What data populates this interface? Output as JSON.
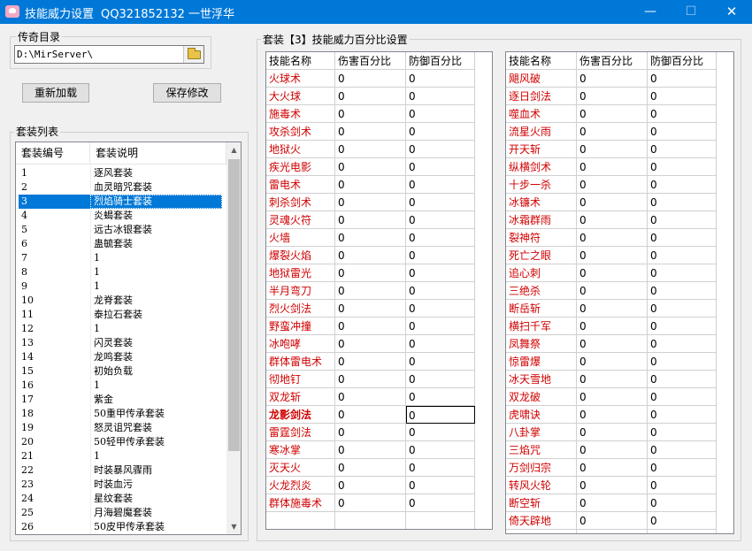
{
  "window": {
    "title": "技能威力设置",
    "subtitle": "QQ321852132 一世浮华",
    "minimize": "—",
    "maximize": "☐",
    "close": "✕"
  },
  "path_group": {
    "label": "传奇目录",
    "path": "D:\\MirServer\\"
  },
  "buttons": {
    "reload": "重新加载",
    "save": "保存修改"
  },
  "suit_list": {
    "label": "套装列表",
    "headers": [
      "套装编号",
      "套装说明"
    ],
    "selected_index": 2,
    "rows": [
      [
        "1",
        "逐风套装"
      ],
      [
        "2",
        "血灵暗咒套装"
      ],
      [
        "3",
        "烈焰骑士套装"
      ],
      [
        "4",
        "炎蝎套装"
      ],
      [
        "5",
        "远古冰银套装"
      ],
      [
        "6",
        "蛊毓套装"
      ],
      [
        "7",
        "1"
      ],
      [
        "8",
        "1"
      ],
      [
        "9",
        "1"
      ],
      [
        "10",
        "龙脊套装"
      ],
      [
        "11",
        "泰拉石套装"
      ],
      [
        "12",
        "1"
      ],
      [
        "13",
        "闪灵套装"
      ],
      [
        "14",
        "龙鸣套装"
      ],
      [
        "15",
        "初始负载"
      ],
      [
        "16",
        "1"
      ],
      [
        "17",
        "紫金"
      ],
      [
        "18",
        "50重甲传承套装"
      ],
      [
        "19",
        "怒灵诅咒套装"
      ],
      [
        "20",
        "50轻甲传承套装"
      ],
      [
        "21",
        "1"
      ],
      [
        "22",
        "时装暴风骤雨"
      ],
      [
        "23",
        "时装血污"
      ],
      [
        "24",
        "星纹套装"
      ],
      [
        "25",
        "月海碧魔套装"
      ],
      [
        "26",
        "50皮甲传承套装"
      ]
    ]
  },
  "skill_group": {
    "label": "套装【3】技能威力百分比设置",
    "headers": [
      "技能名称",
      "伤害百分比",
      "防御百分比"
    ],
    "left_table": [
      [
        "火球术",
        "0",
        "0"
      ],
      [
        "大火球",
        "0",
        "0"
      ],
      [
        "施毒术",
        "0",
        "0"
      ],
      [
        "攻杀剑术",
        "0",
        "0"
      ],
      [
        "地狱火",
        "0",
        "0"
      ],
      [
        "疾光电影",
        "0",
        "0"
      ],
      [
        "雷电术",
        "0",
        "0"
      ],
      [
        "刺杀剑术",
        "0",
        "0"
      ],
      [
        "灵魂火符",
        "0",
        "0"
      ],
      [
        "火墙",
        "0",
        "0"
      ],
      [
        "爆裂火焰",
        "0",
        "0"
      ],
      [
        "地狱雷光",
        "0",
        "0"
      ],
      [
        "半月弯刀",
        "0",
        "0"
      ],
      [
        "烈火剑法",
        "0",
        "0"
      ],
      [
        "野蛮冲撞",
        "0",
        "0"
      ],
      [
        "冰咆哮",
        "0",
        "0"
      ],
      [
        "群体雷电术",
        "0",
        "0"
      ],
      [
        "彻地钉",
        "0",
        "0"
      ],
      [
        "双龙斩",
        "0",
        "0"
      ],
      [
        "龙影剑法",
        "0",
        "0"
      ],
      [
        "雷霆剑法",
        "0",
        "0"
      ],
      [
        "寒冰掌",
        "0",
        "0"
      ],
      [
        "灭天火",
        "0",
        "0"
      ],
      [
        "火龙烈炎",
        "0",
        "0"
      ],
      [
        "群体施毒术",
        "0",
        "0"
      ]
    ],
    "right_table": [
      [
        "飓风破",
        "0",
        "0"
      ],
      [
        "逐日剑法",
        "0",
        "0"
      ],
      [
        "噬血术",
        "0",
        "0"
      ],
      [
        "流星火雨",
        "0",
        "0"
      ],
      [
        "开天斩",
        "0",
        "0"
      ],
      [
        "纵横剑术",
        "0",
        "0"
      ],
      [
        "十步一杀",
        "0",
        "0"
      ],
      [
        "冰镰术",
        "0",
        "0"
      ],
      [
        "冰霜群雨",
        "0",
        "0"
      ],
      [
        "裂神符",
        "0",
        "0"
      ],
      [
        "死亡之眼",
        "0",
        "0"
      ],
      [
        "追心刺",
        "0",
        "0"
      ],
      [
        "三绝杀",
        "0",
        "0"
      ],
      [
        "断岳斩",
        "0",
        "0"
      ],
      [
        "横扫千军",
        "0",
        "0"
      ],
      [
        "凤舞祭",
        "0",
        "0"
      ],
      [
        "惊雷爆",
        "0",
        "0"
      ],
      [
        "冰天雪地",
        "0",
        "0"
      ],
      [
        "双龙破",
        "0",
        "0"
      ],
      [
        "虎啸诀",
        "0",
        "0"
      ],
      [
        "八卦掌",
        "0",
        "0"
      ],
      [
        "三焰咒",
        "0",
        "0"
      ],
      [
        "万剑归宗",
        "0",
        "0"
      ],
      [
        "转风火轮",
        "0",
        "0"
      ],
      [
        "断空斩",
        "0",
        "0"
      ],
      [
        "倚天辟地",
        "0",
        "0"
      ]
    ]
  },
  "colors": {
    "titlebar": "#0078d7",
    "skill_name": "#d00000",
    "selection": "#0078d7"
  }
}
